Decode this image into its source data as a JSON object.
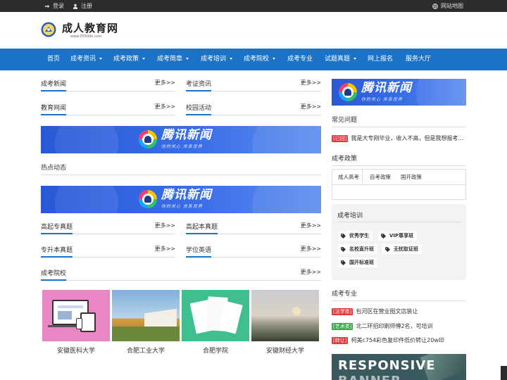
{
  "topbar": {
    "login": "登录",
    "register": "注册",
    "sitemap": "网站地图"
  },
  "logo": {
    "title": "成人教育网",
    "domain": "www.0550dx.com"
  },
  "nav": {
    "items": [
      {
        "label": "首页"
      },
      {
        "label": "成考资讯"
      },
      {
        "label": "成考政策"
      },
      {
        "label": "成考简章"
      },
      {
        "label": "成考培训"
      },
      {
        "label": "成考院校"
      },
      {
        "label": "成考专业"
      },
      {
        "label": "试题真题"
      },
      {
        "label": "网上报名"
      },
      {
        "label": "服务大厅"
      }
    ]
  },
  "sections": {
    "more": "更多>>",
    "news": "成考新闻",
    "cert": "考证资讯",
    "edu_news": "教育网闻",
    "campus": "校园活动",
    "hot": "热点动态",
    "gaoqizhuan": "高起专真题",
    "gaoqiben": "高起本真题",
    "zhuanshengben": "专升本真题",
    "degree_english": "学位英语",
    "schools": "成考院校"
  },
  "banner": {
    "title": "腾讯新闻",
    "subtitle": "你的关心  关系世界"
  },
  "schools": [
    {
      "name": "安徽医科大学"
    },
    {
      "name": "合肥工业大学"
    },
    {
      "name": "合肥学院"
    },
    {
      "name": "安徽财经大学"
    }
  ],
  "sidebar": {
    "faq_title": "常见问题",
    "faq_tag": "[已回]",
    "faq_text": "我是大专刚毕业，收入不高，但是我想报考...",
    "policy_title": "成考政策",
    "tabs": [
      "成人高考",
      "自考政策",
      "国开政策"
    ],
    "train_title": "成考培训",
    "train_items": [
      "优秀学生",
      "VIP尊享班",
      "名校直升班",
      "无忧取证班",
      "国开标准班"
    ],
    "major_title": "成考专业",
    "majors": [
      {
        "tag": "[法学类]",
        "text": "包河区在营业图文店装让",
        "color": "#e2383b"
      },
      {
        "tag": "[艺术类]",
        "text": "北二环招印刷师傅2名，可培训",
        "color": "#3aa84a"
      },
      {
        "tag": "[转让]",
        "text": "柯美c754彩色复印件低价转让20w印",
        "color": "#e2383b"
      }
    ],
    "resp_banner": "RESPONSIVE",
    "resp_banner_2": "BANNER"
  },
  "colors": {
    "nav": "#1a73c8",
    "topbar": "#2c2c2c",
    "tag_red": "#e2383b",
    "tag_green": "#3aa84a"
  }
}
